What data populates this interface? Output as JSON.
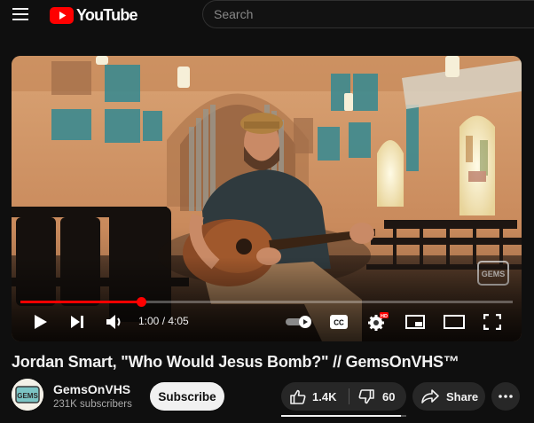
{
  "header": {
    "logo_text": "YouTube",
    "search_placeholder": "Search",
    "icons": {
      "menu": "hamburger-menu-icon",
      "logo": "youtube-play-logo-icon"
    }
  },
  "player": {
    "time_current": "1:00",
    "time_separator": " / ",
    "time_total": "4:05",
    "progress_fraction": 0.245,
    "hd_badge": "HD",
    "watermark_text": "GEMS",
    "accent_color": "#ff0000",
    "icons": {
      "play": "play-icon",
      "next": "next-icon",
      "volume": "volume-icon",
      "autoplay": "autoplay-toggle-icon",
      "captions": "captions-icon",
      "settings": "settings-gear-icon",
      "miniplayer": "miniplayer-icon",
      "theater": "theater-mode-icon",
      "fullscreen": "fullscreen-icon"
    }
  },
  "video": {
    "title": "Jordan Smart, \"Who Would Jesus Bomb?\" // GemsOnVHS™"
  },
  "channel": {
    "name": "GemsOnVHS",
    "subscribers": "231K subscribers",
    "subscribe_label": "Subscribe",
    "avatar_text": "GEMS"
  },
  "actions": {
    "likes": "1.4K",
    "dislikes": "60",
    "like_ratio": 0.96,
    "share_label": "Share",
    "icons": {
      "like": "thumbs-up-icon",
      "dislike": "thumbs-down-icon",
      "share": "share-arrow-icon",
      "more": "more-horizontal-icon"
    }
  }
}
